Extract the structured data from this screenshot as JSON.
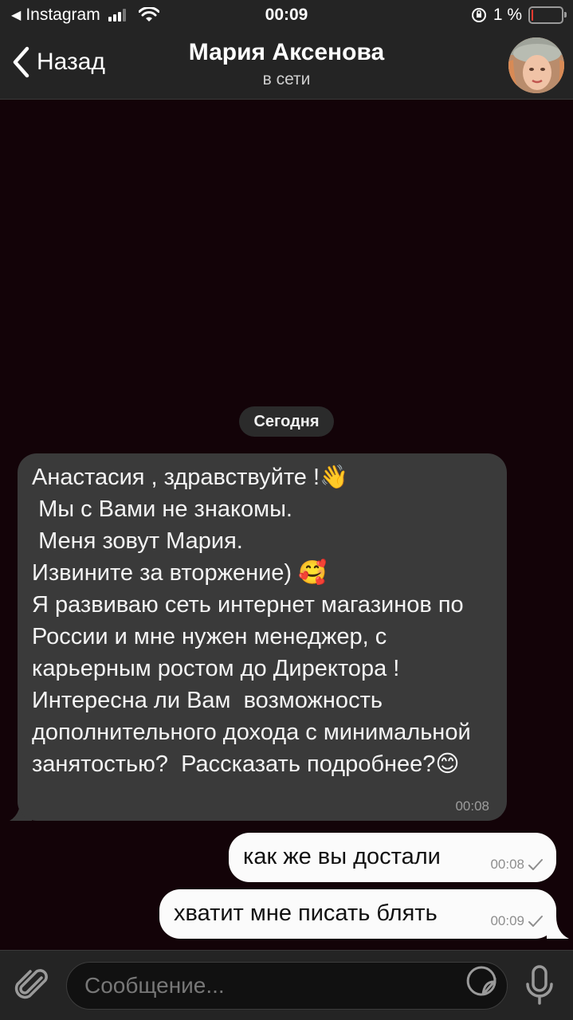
{
  "status_bar": {
    "back_app": "Instagram",
    "time": "00:09",
    "battery": "1 %",
    "battery_level": 0.01
  },
  "header": {
    "back_label": "Назад",
    "title": "Мария Аксенова",
    "status": "в сети"
  },
  "chat": {
    "date_label": "Сегодня",
    "incoming": {
      "text": "Анастасия , здравствуйте !👋\n Мы с Вами не знакомы.\n Меня зовут Мария.\nИзвините за вторжение) 🥰\nЯ развиваю сеть интернет магазинов по России и мне нужен менеджер, с карьерным ростом до Директора !\nИнтересна ли Вам  возможность дополнительного дохода с минимальной занятостью?  Рассказать подробнее?😊",
      "time": "00:08"
    },
    "outgoing": [
      {
        "text": "как же вы достали",
        "time": "00:08"
      },
      {
        "text": "хватит мне писать блять",
        "time": "00:09"
      }
    ]
  },
  "composer": {
    "placeholder": "Сообщение..."
  },
  "icons": {
    "attach": "paperclip-icon",
    "sticker": "sticker-icon",
    "mic": "microphone-icon",
    "check": "check-icon"
  }
}
